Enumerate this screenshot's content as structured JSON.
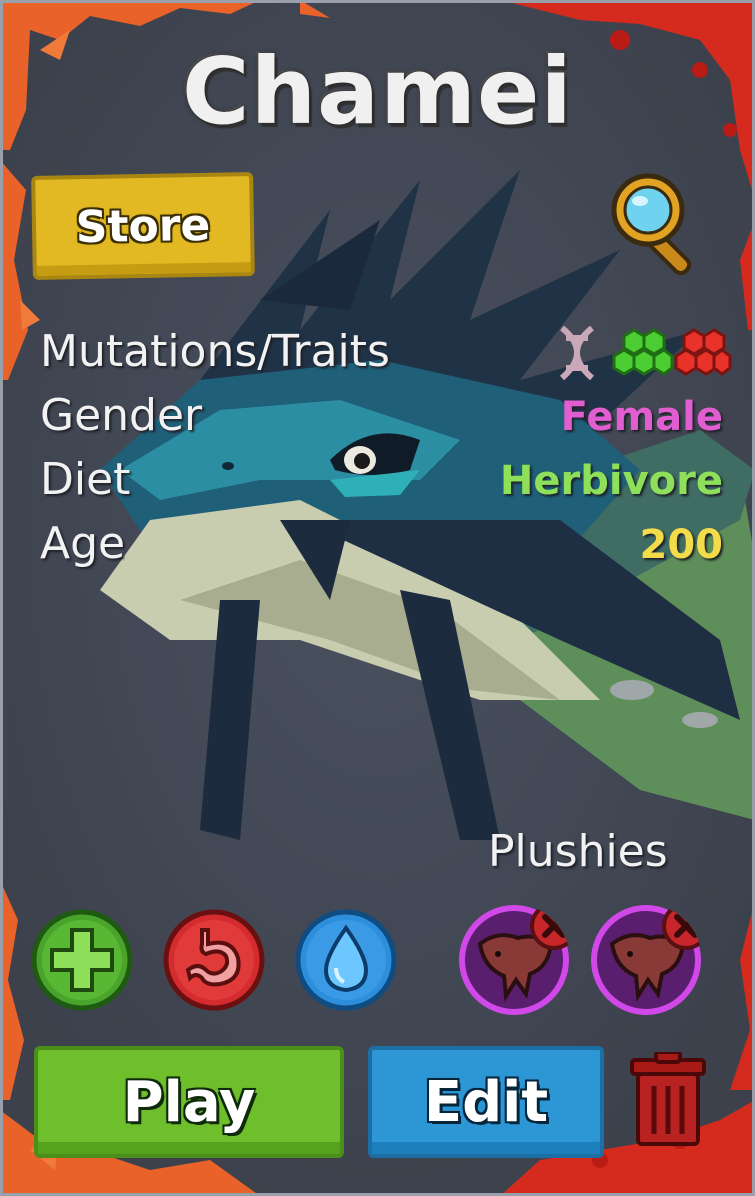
{
  "creature": {
    "name": "Chamei"
  },
  "header": {
    "store_label": "Store",
    "search_icon": "magnifier-icon"
  },
  "stats": {
    "mutations_label": "Mutations/Traits",
    "gender_label": "Gender",
    "gender_value": "Female",
    "diet_label": "Diet",
    "diet_value": "Herbivore",
    "age_label": "Age",
    "age_value": "200",
    "trait_icons": [
      "dna-icon",
      "green-hex-cluster-icon",
      "red-hex-cluster-icon"
    ]
  },
  "plushies": {
    "label": "Plushies",
    "slots": [
      {
        "icon": "plush-icon",
        "remove_icon": "close-icon"
      },
      {
        "icon": "plush-icon",
        "remove_icon": "close-icon"
      }
    ]
  },
  "needs": {
    "icons": [
      "health-plus-icon",
      "stomach-icon",
      "water-drop-icon"
    ]
  },
  "actions": {
    "play_label": "Play",
    "edit_label": "Edit",
    "delete_icon": "trash-icon"
  },
  "colors": {
    "gender_female": "#e05ed0",
    "diet_herbivore": "#8ee05a",
    "age": "#f3dc4a",
    "frame_orange": "#e8622a",
    "frame_red": "#d42b1e",
    "store_yellow": "#e2b922",
    "play_green": "#6fbe2c",
    "edit_blue": "#2d97d6"
  }
}
